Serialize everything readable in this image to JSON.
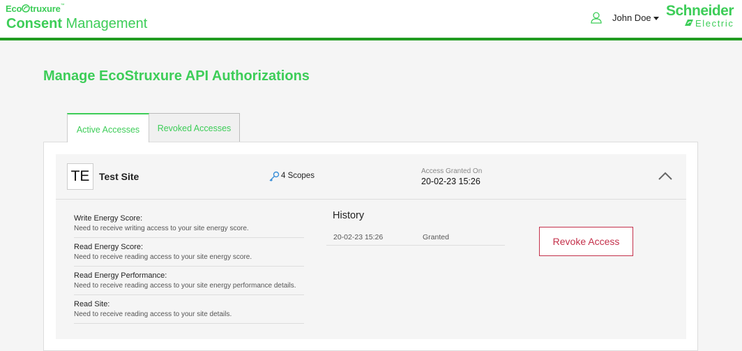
{
  "header": {
    "brand": "Eco",
    "brand_struxure": "truxure",
    "app_title_bold": "Consent",
    "app_title_rest": " Management",
    "user_name": "John Doe",
    "company_line1": "Schneider",
    "company_line2": "Electric"
  },
  "page": {
    "title": "Manage EcoStruxure API Authorizations"
  },
  "tabs": [
    {
      "label": "Active Accesses",
      "active": true
    },
    {
      "label": "Revoked Accesses",
      "active": false
    }
  ],
  "site": {
    "initials": "TE",
    "name": "Test Site",
    "scopes_label": "4 Scopes",
    "granted_label": "Access Granted On",
    "granted_on": "20-02-23 15:26"
  },
  "scopes": [
    {
      "title": "Write Energy Score:",
      "desc": "Need to receive writing access to your site energy score."
    },
    {
      "title": "Read Energy Score:",
      "desc": "Need to receive reading access to your site energy score."
    },
    {
      "title": "Read Energy Performance:",
      "desc": "Need to receive reading access to your site energy performance details."
    },
    {
      "title": "Read Site:",
      "desc": "Need to receive reading access to your site details."
    }
  ],
  "history": {
    "title": "History",
    "rows": [
      {
        "date": "20-02-23 15:26",
        "status": "Granted"
      }
    ]
  },
  "actions": {
    "revoke_label": "Revoke Access"
  },
  "colors": {
    "brand_green": "#3dcd58",
    "header_bar": "#219b21",
    "danger": "#c4314b"
  }
}
